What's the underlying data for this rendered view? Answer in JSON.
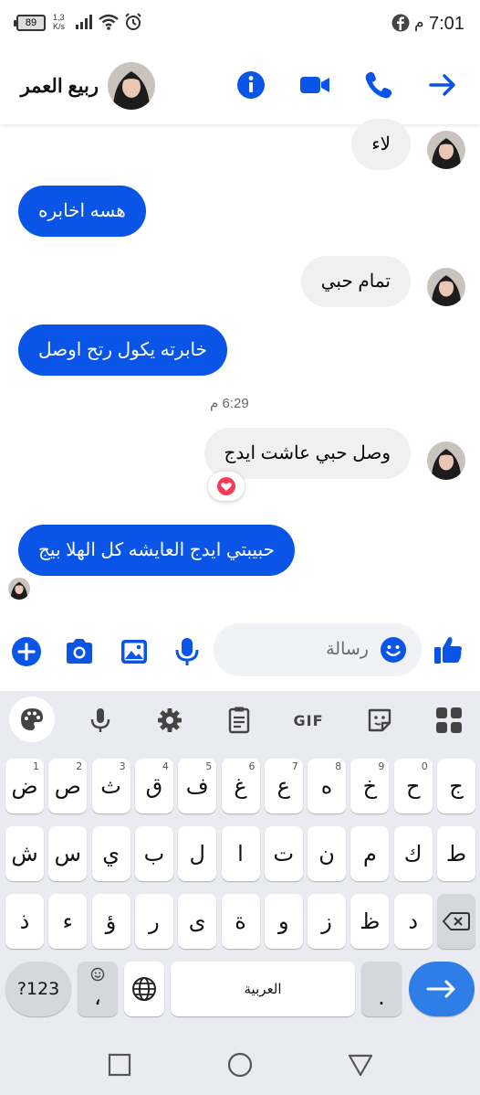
{
  "status_bar": {
    "time": "7:01",
    "am_pm": "م",
    "battery": "89",
    "net_speed": "1,3",
    "net_unit": "K/s",
    "icons": [
      "facebook-icon",
      "signal-icon",
      "wifi-icon",
      "alarm-icon"
    ]
  },
  "header": {
    "contact_name": "ربيع العمر",
    "icons": [
      "info-icon",
      "video-call-icon",
      "phone-icon",
      "back-arrow-icon"
    ]
  },
  "messages": [
    {
      "side": "received",
      "text": "لاء"
    },
    {
      "side": "sent",
      "text": "هسه اخابره"
    },
    {
      "side": "received",
      "text": "تمام حبي"
    },
    {
      "side": "sent",
      "text": "خابرته يكول رتح اوصل"
    },
    {
      "side": "separator",
      "text": "6:29 م"
    },
    {
      "side": "received",
      "text": "وصل حبي عاشت ايدج",
      "reaction": "heart"
    },
    {
      "side": "sent",
      "text": "حبيبتي ايدج العايشه كل الهلا بيج"
    }
  ],
  "composer": {
    "placeholder": "رسالة",
    "icons": [
      "add-icon",
      "camera-icon",
      "gallery-icon",
      "microphone-icon",
      "emoji-icon",
      "like-icon"
    ]
  },
  "keyboard": {
    "toolbar": [
      "palette-icon",
      "voice-input-icon",
      "settings-icon",
      "clipboard-icon",
      "gif-button",
      "sticker-icon",
      "apps-grid-icon"
    ],
    "gif_label": "GIF",
    "row1": [
      {
        "k": "ض",
        "h": "1"
      },
      {
        "k": "ص",
        "h": "2"
      },
      {
        "k": "ث",
        "h": "3"
      },
      {
        "k": "ق",
        "h": "4"
      },
      {
        "k": "ف",
        "h": "5"
      },
      {
        "k": "غ",
        "h": "6"
      },
      {
        "k": "ع",
        "h": "7"
      },
      {
        "k": "ه",
        "h": "8"
      },
      {
        "k": "خ",
        "h": "9"
      },
      {
        "k": "ح",
        "h": "0"
      },
      {
        "k": "ج",
        "h": ""
      }
    ],
    "row2": [
      "ش",
      "س",
      "ي",
      "ب",
      "ل",
      "ا",
      "ت",
      "ن",
      "م",
      "ك",
      "ط"
    ],
    "row3": [
      "ذ",
      "ء",
      "ؤ",
      "ر",
      "ى",
      "ة",
      "و",
      "ز",
      "ظ",
      "د"
    ],
    "symbols_key": "?123",
    "comma_key": "،",
    "space_label": "العربية",
    "period_key": "."
  },
  "colors": {
    "accent": "#0a55e8",
    "received_bubble": "#f0f0f0",
    "keyboard_bg": "#e9ebf0",
    "enter_key": "#2f7de6",
    "heart": "#f33e58"
  }
}
